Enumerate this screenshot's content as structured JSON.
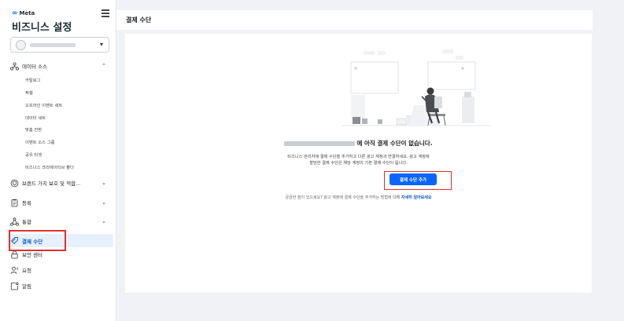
{
  "brand": {
    "logo_text": "Meta",
    "logo_symbol": "∞"
  },
  "sidebar": {
    "title": "비즈니스 설정",
    "data_sources": {
      "label": "데이터 소스",
      "items": [
        "카탈로그",
        "픽셀",
        "오프라인 이벤트 세트",
        "데이터 세트",
        "맞춤 전환",
        "이벤트 소스 그룹",
        "공유 타겟",
        "비즈니스 크리에이티브 폴더"
      ]
    },
    "nav": {
      "brand_safety": "브랜드 가치 보호 및 적합...",
      "registration": "등록",
      "integrations": "통합",
      "payment_methods": "결제 수단",
      "security_center": "보안 센터",
      "requests": "요청",
      "notifications": "알림"
    }
  },
  "main": {
    "page_title": "결제 수단",
    "empty_title": "에 아직 결제 수단이 없습니다.",
    "desc_line1": "비즈니스 관리자에 결제 수단을 추가하고 다른 광고 계정과 연결하세요. 광고 계정에",
    "desc_line2": "할당한 결제 수단은 해당 계정의 기본 결제 수단이 됩니다.",
    "add_button": "결제 수단 추가",
    "footnote_text": "궁금한 점이 있으세요? 광고 계정에 결제 수단을 추가하는 방법에 대해",
    "footnote_link": "자세히 알아보세요"
  },
  "colors": {
    "accent": "#0866ff",
    "highlight": "#e0312c",
    "active_bg": "#e7f0fd"
  }
}
